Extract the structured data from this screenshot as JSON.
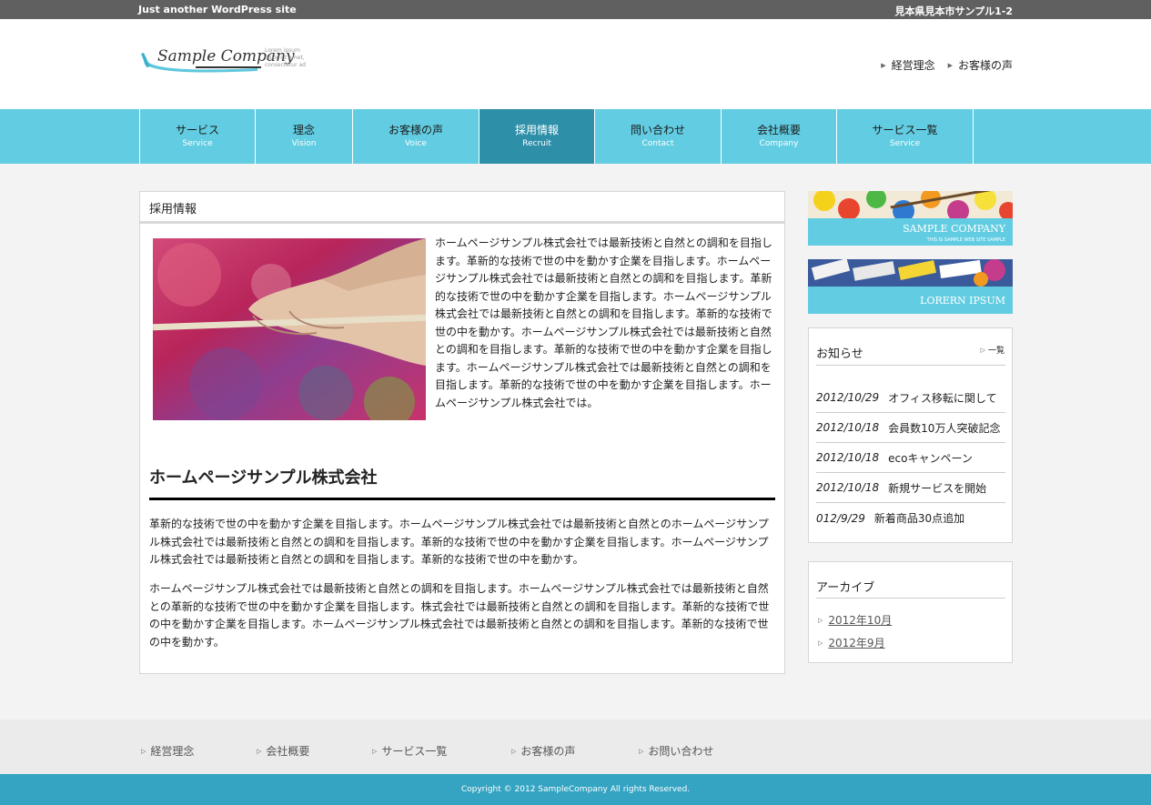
{
  "topbar": {
    "tagline": "Just another WordPress site",
    "address": "見本県見本市サンプル1-2"
  },
  "logo": {
    "script_text": "Sample Company",
    "tag_text": "Lorem ipsum dolor sit amet, consectetur ad"
  },
  "header_links": [
    {
      "label": "経営理念"
    },
    {
      "label": "お客様の声"
    }
  ],
  "nav": [
    {
      "jp": "サービス",
      "en": "Service"
    },
    {
      "jp": "理念",
      "en": "Vision"
    },
    {
      "jp": "お客様の声",
      "en": "Voice"
    },
    {
      "jp": "採用情報",
      "en": "Recruit",
      "active": true
    },
    {
      "jp": "問い合わせ",
      "en": "Contact"
    },
    {
      "jp": "会社概要",
      "en": "Company"
    },
    {
      "jp": "サービス一覧",
      "en": "Service"
    }
  ],
  "main": {
    "heading": "採用情報",
    "intro": "ホームページサンプル株式会社では最新技術と自然との調和を目指します。革新的な技術で世の中を動かす企業を目指します。ホームページサンプル株式会社では最新技術と自然との調和を目指します。革新的な技術で世の中を動かす企業を目指します。ホームページサンプル株式会社では最新技術と自然との調和を目指します。革新的な技術で世の中を動かす。ホームページサンプル株式会社では最新技術と自然との調和を目指します。革新的な技術で世の中を動かす企業を目指します。ホームページサンプル株式会社では最新技術と自然との調和を目指します。革新的な技術で世の中を動かす企業を目指します。ホームページサンプル株式会社では。",
    "company_heading": "ホームページサンプル株式会社",
    "para1": "革新的な技術で世の中を動かす企業を目指します。ホームページサンプル株式会社では最新技術と自然とのホームページサンプル株式会社では最新技術と自然との調和を目指します。革新的な技術で世の中を動かす企業を目指します。ホームページサンプル株式会社では最新技術と自然との調和を目指します。革新的な技術で世の中を動かす。",
    "para2": "ホームページサンプル株式会社では最新技術と自然との調和を目指します。ホームページサンプル株式会社では最新技術と自然との革新的な技術で世の中を動かす企業を目指します。株式会社では最新技術と自然との調和を目指します。革新的な技術で世の中を動かす企業を目指します。ホームページサンプル株式会社では最新技術と自然との調和を目指します。革新的な技術で世の中を動かす。"
  },
  "banners": [
    {
      "label": "SAMPLE COMPANY",
      "sub": "THIS IS SAMPLE WEB SITE SAMPLE"
    },
    {
      "label": "LORERN IPSUM"
    }
  ],
  "news": {
    "title": "お知らせ",
    "more": "一覧",
    "items": [
      {
        "date": "2012/10/29",
        "text": "オフィス移転に関して"
      },
      {
        "date": "2012/10/18",
        "text": "会員数10万人突破記念"
      },
      {
        "date": "2012/10/18",
        "text": "ecoキャンペーン"
      },
      {
        "date": "2012/10/18",
        "text": "新規サービスを開始"
      },
      {
        "date": "012/9/29",
        "text": "新着商品30点追加"
      }
    ]
  },
  "archive": {
    "title": "アーカイブ",
    "items": [
      {
        "label": "2012年10月"
      },
      {
        "label": "2012年9月"
      }
    ]
  },
  "footer_nav": [
    {
      "label": "経営理念"
    },
    {
      "label": "会社概要"
    },
    {
      "label": "サービス一覧"
    },
    {
      "label": "お客様の声"
    },
    {
      "label": "お問い合わせ"
    }
  ],
  "copyright": "Copyright © 2012 SampleCompany All rights Reserved.",
  "colors": {
    "accent": "#62cde2",
    "nav_active": "#2e8fa8",
    "footer": "#34a4c2",
    "topbar": "#606060"
  }
}
